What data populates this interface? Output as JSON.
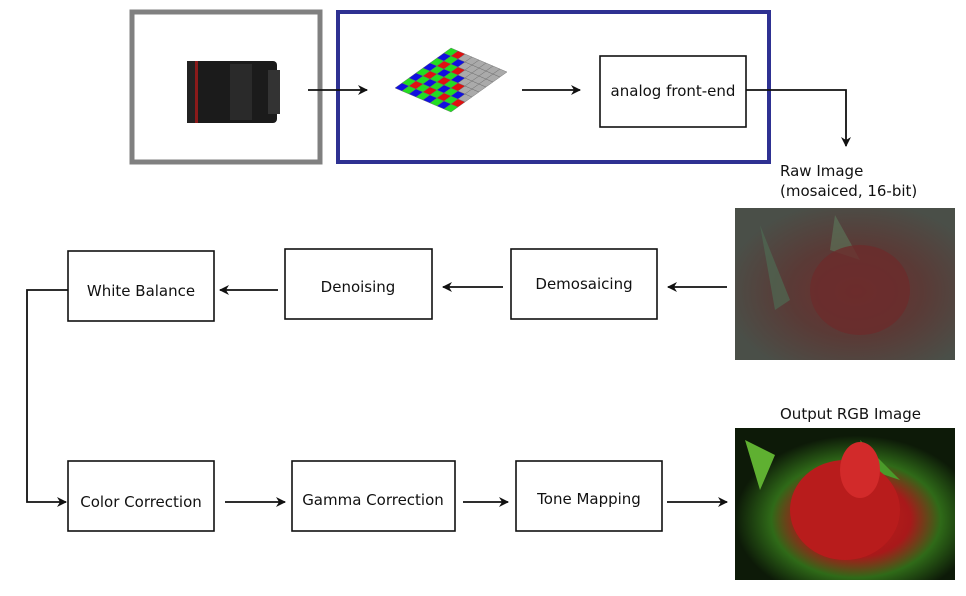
{
  "camera": {
    "lens_icon": "camera-lens-icon",
    "sensor_icon": "bayer-sensor-icon",
    "analog_front_end": "analog front-end",
    "lens_frame_color": "#808080",
    "sensor_frame_color": "#2e3192"
  },
  "raw_image": {
    "title_line1": "Raw Image",
    "title_line2": "(mosaiced, 16-bit)"
  },
  "output_image": {
    "title": "Output RGB Image"
  },
  "pipeline": {
    "demosaicing": "Demosaicing",
    "denoising": "Denoising",
    "white_balance": "White Balance",
    "color_correction": "Color Correction",
    "gamma_correction": "Gamma Correction",
    "tone_mapping": "Tone Mapping"
  }
}
